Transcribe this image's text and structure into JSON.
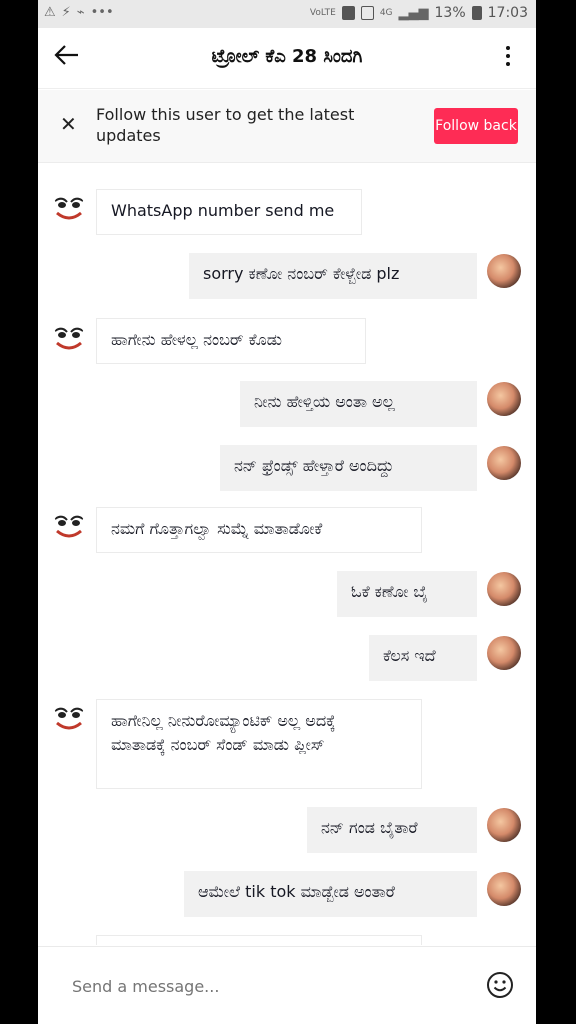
{
  "status_bar": {
    "left_icons": [
      "warning-icon",
      "bolt-icon",
      "usb-icon",
      "more-icon"
    ],
    "network": "VoLTE",
    "signal": "4G",
    "battery": "13%",
    "time": "17:03"
  },
  "header": {
    "title": "ಟ್ರೋಲ್ ಕೆಎ 28 ಸಿಂದಗಿ",
    "back_icon": "arrow-left-icon",
    "more_icon": "more-vertical-icon"
  },
  "follow_banner": {
    "text": "Follow this user to get the latest updates",
    "button_label": "Follow back",
    "button_color": "#fe2c55"
  },
  "messages": [
    {
      "side": "left",
      "text": "WhatsApp number send me"
    },
    {
      "side": "right",
      "text": "sorry ಕಣೋ ನಂಬರ್ ಕೇಳ್ಬೇಡ plz"
    },
    {
      "side": "left",
      "text": "ಹಾಗೇನು ಹೇಳಲ್ಲ ನಂಬರ್ ಕೊಡು"
    },
    {
      "side": "right",
      "text": "ನೀನು ಹೇಳ್ತಿಯ ಅಂತಾ ಅಲ್ಲ"
    },
    {
      "side": "right",
      "text": "ನನ್ ಫ್ರೆಂಡ್ಸ್ ಹೇಳ್ತಾರೆ ಅಂದಿದ್ದು"
    },
    {
      "side": "left",
      "text": "ನಮಗೆ ಗೊತ್ತಾಗಲ್ವಾ ಸುಮ್ನೆ ಮಾತಾಡೋಕೆ"
    },
    {
      "side": "right",
      "text": "ಓಕೆ ಕಣೋ ಬೈ"
    },
    {
      "side": "right",
      "text": "ಕೆಲಸ ಇದೆ"
    },
    {
      "side": "left",
      "text": "ಹಾಗೇನಿಲ್ಲ ನೀನುರೋಮ್ಯಾಂಟಿಕ್ ಅಲ್ಲ ಅದಕ್ಕೆ ಮಾತಾಡಕ್ಕೆ ನಂಬರ್ ಸೆಂಡ್ ಮಾಡು ಪ್ಲೀಸ್"
    },
    {
      "side": "right",
      "text": "ನನ್ ಗಂಡ ಬೈತಾರೆ"
    },
    {
      "side": "right",
      "text": "ಆಮೇಲೆ tik tok ಮಾಡ್ಬೇಡ ಅಂತಾರೆ"
    }
  ],
  "composer": {
    "placeholder": "Send a message...",
    "emoji_icon": "smiley-icon"
  }
}
